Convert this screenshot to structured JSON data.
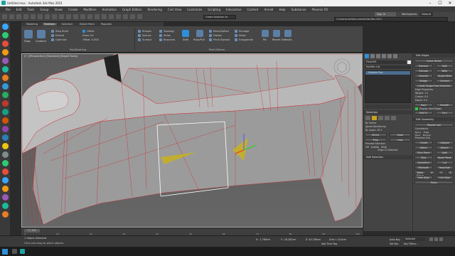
{
  "window": {
    "title": "Untitled.max - Autodesk 3ds Max 2021",
    "controls": [
      "–",
      "☐",
      "✕"
    ]
  },
  "menu": [
    "File",
    "Edit",
    "Tools",
    "Group",
    "Views",
    "Create",
    "Modifiers",
    "Animation",
    "Graph Editors",
    "Rendering",
    "Civil View",
    "Customize",
    "Scripting",
    "Interactive",
    "Content",
    "Arnold",
    "Help",
    "Substance",
    "Phoenix FD"
  ],
  "account": {
    "sign_in": "Sign In",
    "workspaces_label": "Workspaces:",
    "workspace": "Default"
  },
  "quick": {
    "selection_set": "Create Selection Se",
    "path": "C:\\Users\\rave\\Documents\\3ds Max 2021"
  },
  "ribbon": {
    "tabs": [
      "Modeling",
      "Freeform",
      "Selection",
      "Object Paint",
      "Populate"
    ],
    "active_tab": 1,
    "groups": {
      "polymodel": {
        "label": "PolyModeling",
        "items": [
          "Drag",
          "Conform",
          "Step Build",
          "Extend",
          "Optimize",
          "Offset",
          "Draw On:",
          "Offset: 0.000"
        ]
      },
      "paint": {
        "label": "Paint Deform",
        "items": [
          "Shapes",
          "Splines",
          "Surface",
          "Topology",
          "Strips",
          "Branches",
          "Shift",
          "Push/Pull",
          "Relax/Soften",
          "Flatten",
          "Pinch/Spread",
          "Smudge",
          "Noise",
          "Exaggerate",
          "Pin",
          "Revert",
          "Defaults"
        ]
      }
    }
  },
  "viewport": {
    "label": "[+] [Perspective] [Standard] [Edged Faces]"
  },
  "command_panel": {
    "object_name": "Plane001",
    "modifier_list": "Modifier List",
    "stack_item": "Editable Poly",
    "selection_header": "Selection",
    "by_vertex": "By Vertex",
    "ignore_backfacing": "Ignore Backfacing",
    "by_angle": "By Angle: 45.0",
    "shrink": "Shrink",
    "grow": "Grow",
    "ring": "Ring",
    "loop": "Loop",
    "preview_selection": "Preview Selection",
    "preview_options": [
      "Off",
      "SubObj",
      "Multi"
    ],
    "selected_info": "Edge 10 Selected",
    "soft_selection": "Soft Selection"
  },
  "edit_edges": {
    "header": "Edit Edges",
    "insert_vertex": "Insert Vertex",
    "remove": "Remove",
    "split": "Split",
    "extrude": "Extrude",
    "weld": "Weld",
    "chamfer": "Chamfer",
    "target_weld": "Target Weld",
    "bridge": "Bridge",
    "connect": "Connect",
    "create_shape": "Create Shape From Selection",
    "edge_properties": "Edge Properties",
    "weight": "Weight: 1.0",
    "crease": "Crease: 0.0",
    "depth": "Depth: 0.0",
    "hard": "Hard",
    "smooth": "Smooth",
    "display_hard": "Display Hard Edges",
    "edit_tri": "Edit Tri.",
    "turn": "Turn"
  },
  "edit_geometry": {
    "header": "Edit Geometry",
    "repeat_last": "Repeat Last",
    "constraints": "Constraints",
    "constraint_opts": [
      "None",
      "Edge",
      "Face",
      "Normal"
    ],
    "preserve_uvs": "Preserve UVs",
    "create": "Create",
    "collapse": "Collapse",
    "attach": "Attach",
    "detach": "Detach",
    "slice_plane": "Slice Plane",
    "split": "Split",
    "slice": "Slice",
    "reset_plane": "Reset Plane",
    "quickslice": "QuickSlice",
    "cut": "Cut",
    "meshsmooth": "MSmooth",
    "tessellate": "Tessellate",
    "make_planar": "Make Planar",
    "x": "X",
    "y": "Y",
    "z": "Z",
    "view_align": "View Align",
    "grid_align": "Grid Align",
    "relax": "Relax"
  },
  "trackbar": {
    "frame": "0 / 100",
    "ticks": [
      "0",
      "10",
      "20",
      "30",
      "40",
      "50",
      "60",
      "70",
      "80",
      "90",
      "100"
    ]
  },
  "status": {
    "selected": "1 Object Selected",
    "hint": "Click-and-drag to select objects",
    "x": "X: -1.789cm",
    "y": "Y: -18.262cm",
    "z": "Z: 44.256cm",
    "grid": "Grid = 10.0cm",
    "add_time_tag": "Add Time Tag",
    "auto_key": "Auto Key",
    "selected_btn": "Selected",
    "set_key": "Set Key",
    "key_filters": "Key Filters..."
  },
  "colors": {
    "wire": "#d2232a",
    "accent": "#2f8fd8",
    "mesh": "#9a9a9a",
    "bg": "#5e5e5e"
  }
}
